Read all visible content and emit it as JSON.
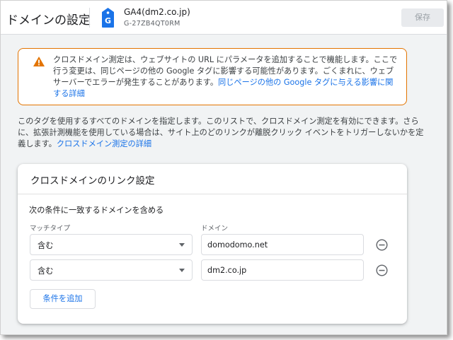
{
  "header": {
    "page_title": "ドメインの設定",
    "property_name": "GA4(dm2.co.jp)",
    "property_id": "G-27ZB4QT0RM",
    "save_label": "保存"
  },
  "warning": {
    "text": "クロスドメイン測定は、ウェブサイトの URL にパラメータを追加することで機能します。ここで行う変更は、同じページの他の Google タグに影響する可能性があります。ごくまれに、ウェブサーバーでエラーが発生することがあります。",
    "link": "同じページの他の Google タグに与える影響に関する詳細"
  },
  "description": {
    "text": "このタグを使用するすべてのドメインを指定します。このリストで、クロスドメイン測定を有効にできます。さらに、拡張計測機能を使用している場合は、サイト上のどのリンクが離脱クリック イベントをトリガーしないかを定義します。",
    "link": "クロスドメイン測定の詳細"
  },
  "card": {
    "title": "クロスドメインのリンク設定",
    "condition_label": "次の条件に一致するドメインを含める",
    "match_type_label": "マッチタイプ",
    "domain_label": "ドメイン",
    "rows": [
      {
        "match_type": "含む",
        "domain": "domodomo.net"
      },
      {
        "match_type": "含む",
        "domain": "dm2.co.jp"
      }
    ],
    "add_label": "条件を追加"
  },
  "colors": {
    "accent": "#1a73e8",
    "warning_border": "#e37400",
    "tag_icon": "#1a73e8"
  },
  "icons": [
    "tag-icon",
    "warning-icon",
    "chevron-down-icon",
    "remove-circle-icon"
  ]
}
